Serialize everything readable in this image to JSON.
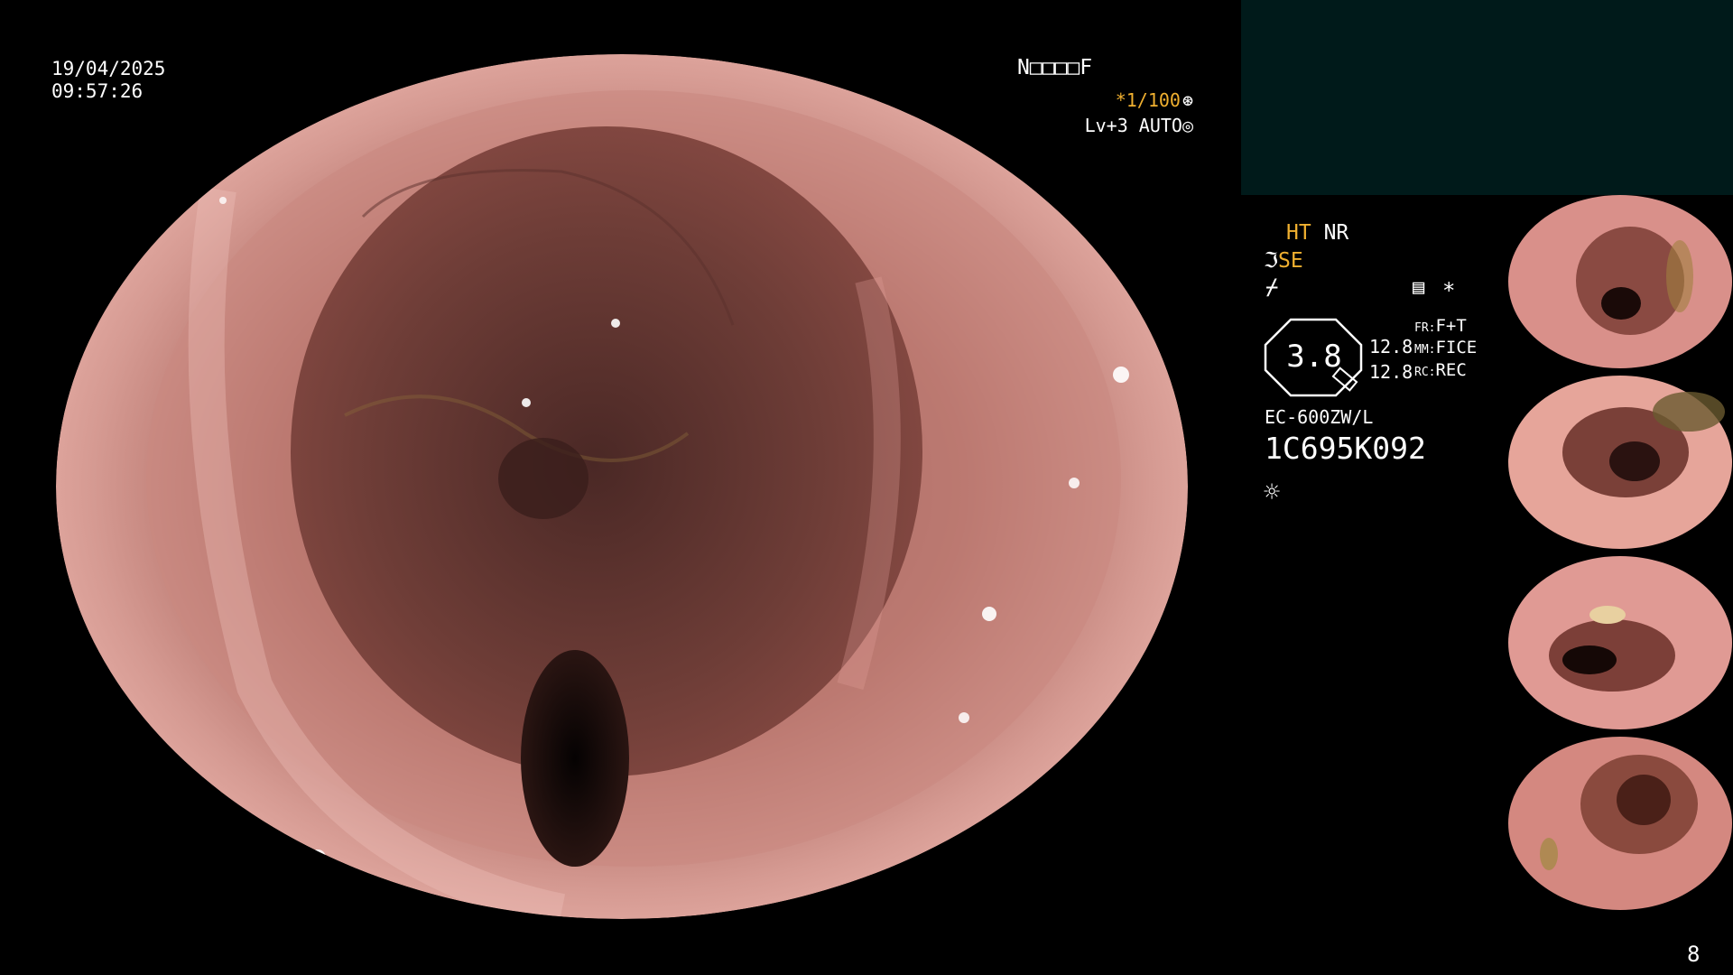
{
  "overlay": {
    "date": "19/04/2025",
    "time": "09:57:26",
    "patient_id": "N□□□□F",
    "shutter": "*1/100",
    "shutter_icon": "⊛",
    "level": "Lv+3 AUTO",
    "level_icon": "◎"
  },
  "status": {
    "ht": "HT",
    "nr": "NR",
    "se_symbol": "ℑ",
    "se": "SE",
    "flash_icon": "⌿",
    "report_icon": "▤",
    "star": "*",
    "zoom": "3.8",
    "value_1": "12.8",
    "value_2": "12.8",
    "fr_label": "FR:",
    "fr_value": "F+T",
    "mm_label": "MM:",
    "mm_value": "FICE",
    "rc_label": "RC:",
    "rc_value": "REC"
  },
  "scope": {
    "model": "EC-600ZW/L",
    "serial": "1C695K092",
    "light_icon": "☼"
  },
  "page_number": "8",
  "colors": {
    "text": "#ffffff",
    "accent": "#f0b030",
    "panel": "#001a1a"
  }
}
